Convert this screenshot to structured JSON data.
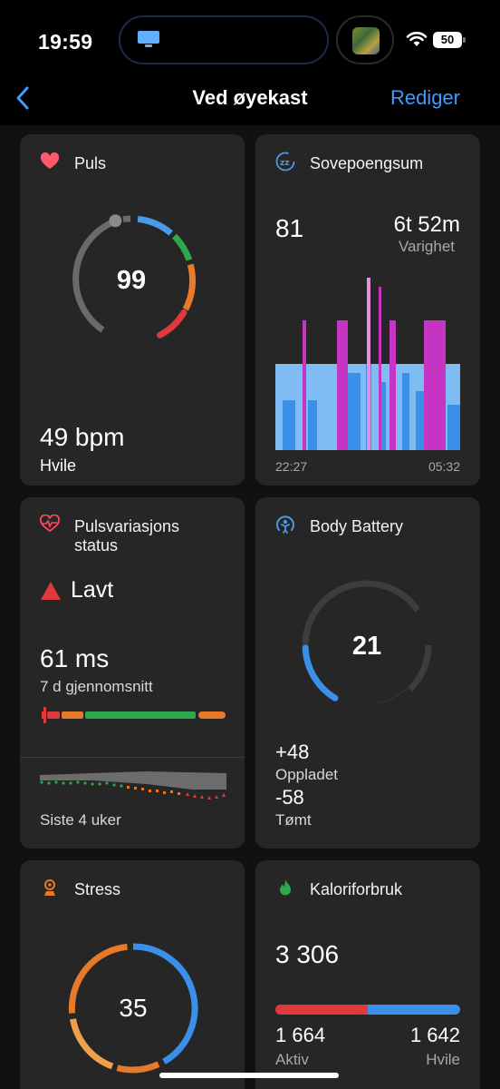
{
  "status_bar": {
    "time": "19:59",
    "battery": "50"
  },
  "nav": {
    "title": "Ved øyekast",
    "edit_label": "Rediger"
  },
  "cards": {
    "pulse": {
      "title": "Puls",
      "value": "99",
      "resting": "49 bpm",
      "resting_label": "Hvile"
    },
    "sleep": {
      "title": "Sovepoengsum",
      "score": "81",
      "duration": "6t 52m",
      "duration_label": "Varighet",
      "start_time": "22:27",
      "end_time": "05:32"
    },
    "hrv": {
      "title_line1": "Pulsvariasjons",
      "title_line2": "status",
      "status": "Lavt",
      "value": "61 ms",
      "avg_label": "7 d gjennomsnitt",
      "weeks_label": "Siste 4 uker"
    },
    "body_battery": {
      "title": "Body Battery",
      "value": "21",
      "level": 0.21,
      "charged": "+48",
      "charged_label": "Oppladet",
      "drained": "-58",
      "drained_label": "Tømt"
    },
    "stress": {
      "title": "Stress",
      "value": "35"
    },
    "calories": {
      "title": "Kaloriforbruk",
      "total": "3 306",
      "active": "1 664",
      "active_label": "Aktiv",
      "resting": "1 642",
      "resting_label": "Hvile"
    }
  },
  "colors": {
    "accent": "#3f9bff",
    "card_bg": "#262626",
    "red": "#e0393b",
    "green": "#2ea84a",
    "orange": "#e8792a",
    "blue": "#3a8fe8",
    "magenta": "#c534c2",
    "light_blue": "#7fbcf4"
  }
}
